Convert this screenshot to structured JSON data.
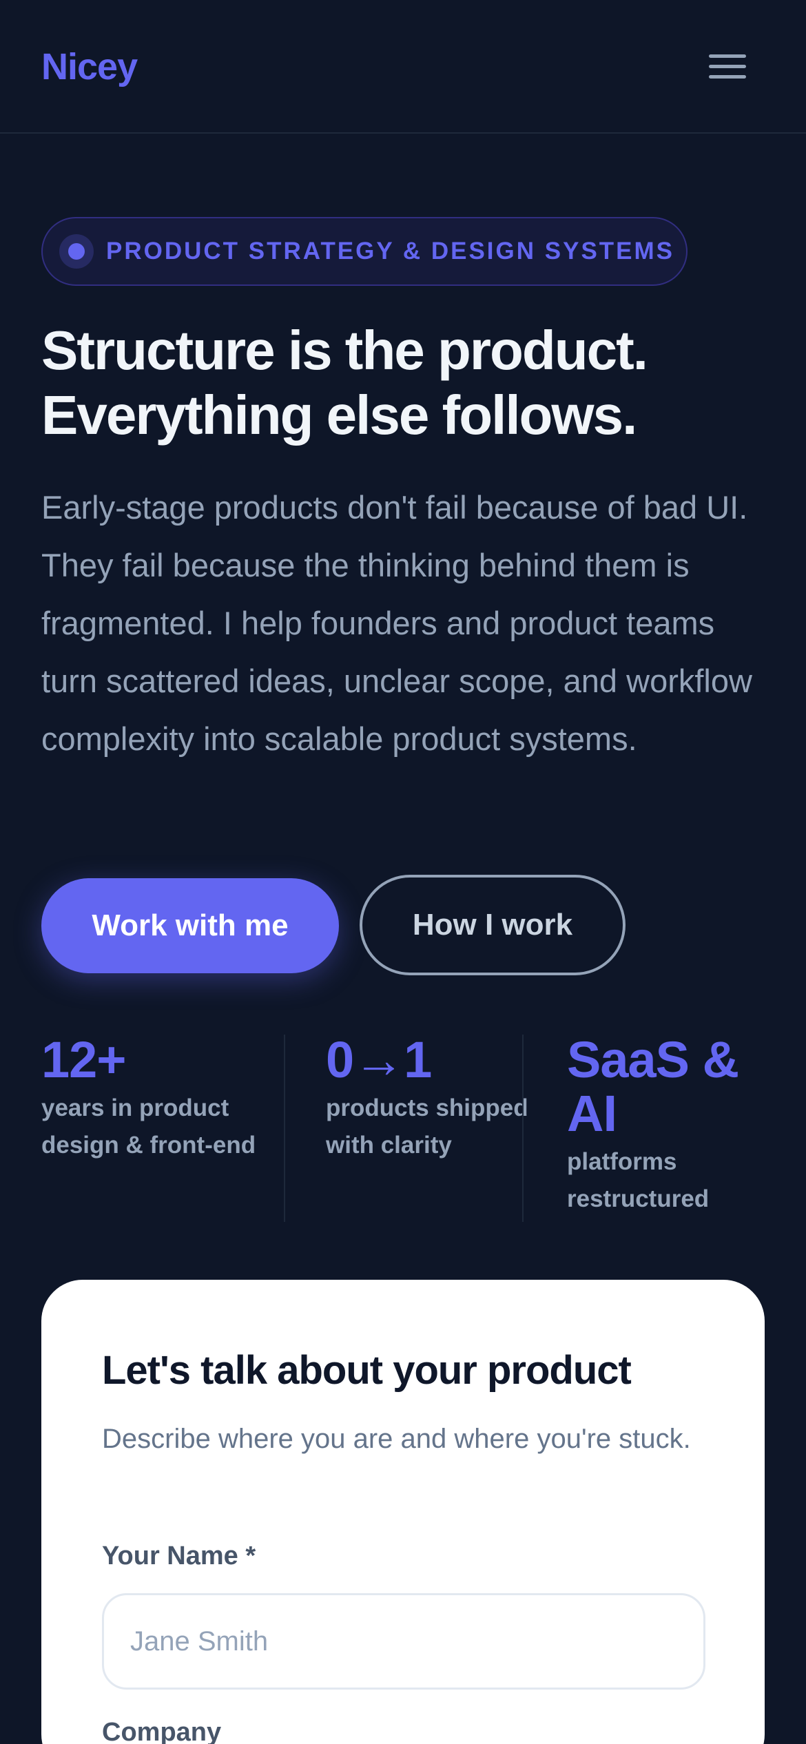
{
  "header": {
    "logo": "Nicey",
    "menu_icon": "hamburger-menu-icon"
  },
  "badge": {
    "text": "PRODUCT STRATEGY & DESIGN SYSTEMS"
  },
  "hero": {
    "title_line1": "Structure is the product.",
    "title_line2": "Everything else follows.",
    "description": "Early-stage products don't fail because of bad UI. They fail because the thinking behind them is fragmented. I help founders and product teams turn scattered ideas, unclear scope, and workflow complexity into scalable product systems.",
    "primary_cta": "Work with me",
    "secondary_cta": "How I work"
  },
  "stats": [
    {
      "value": "12+",
      "label": "years in product design & front-end"
    },
    {
      "value": "0→1",
      "label": "products shipped with clarity"
    },
    {
      "value": "SaaS & AI",
      "label": "platforms restructured"
    }
  ],
  "contact": {
    "title": "Let's talk about your product",
    "subtitle": "Describe where you are and where you're stuck.",
    "name_label": "Your Name *",
    "name_placeholder": "Jane Smith",
    "name_value": "",
    "company_label": "Company"
  },
  "colors": {
    "background": "#0e1628",
    "accent": "#6366f1",
    "muted_text": "#94a3b8",
    "card": "#ffffff"
  }
}
